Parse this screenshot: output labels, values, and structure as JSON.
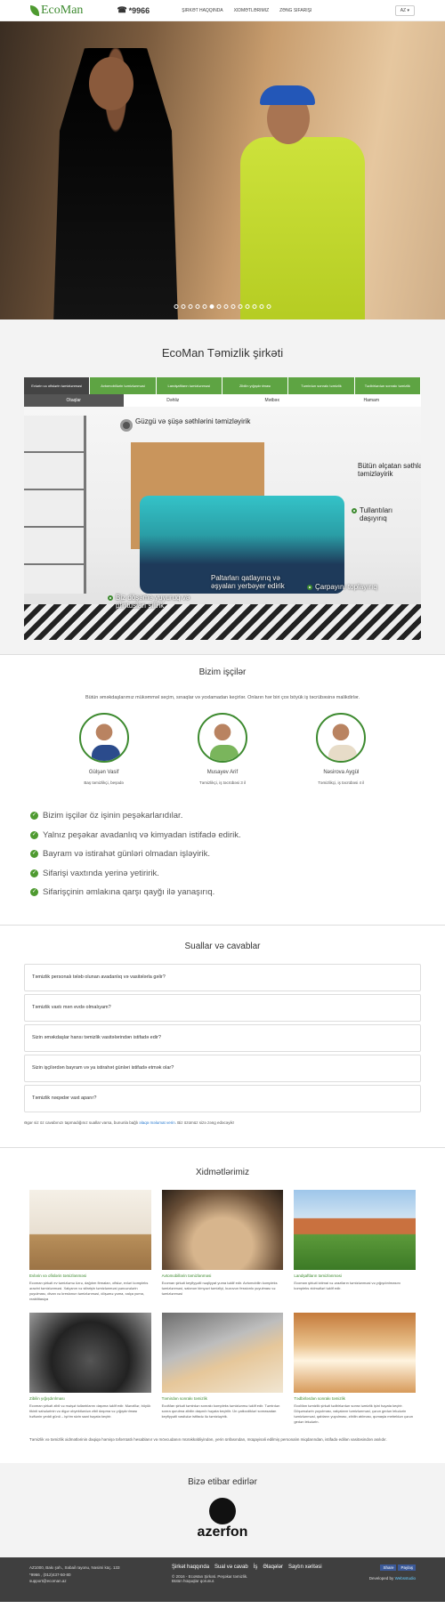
{
  "header": {
    "logo": "EcoMan",
    "phone": "*9966",
    "nav": [
      "Şirkət haqqında",
      "Xidmətlərimiz",
      "Zəng sifarişi"
    ],
    "lang": "AZ ▾"
  },
  "hero": {
    "slide_count": 14,
    "active_slide": 5
  },
  "company": {
    "title": "EcoMan Təmizlik şirkəti",
    "tabs": [
      "Evlərin və ofislərin təmizlənməsi",
      "Avtomobillərin təmizlənməsi",
      "Landşaftların təmizlənməsi",
      "Zibilin yığışdırılması",
      "Təmirdən sonrakı təmizlik",
      "Tədbirlərdən sonrakı təmizlik"
    ],
    "subtabs": [
      "Otaqlar",
      "Dəhliz",
      "Mətbəx",
      "Hamam"
    ],
    "hotspots": {
      "glass": "Güzgü və şüşə səthlərini təmizləyirik",
      "surfaces": "Bütün əlçatan səthləri təmizləyirik",
      "trash": "Tullantıları daşıyırıq",
      "clothes": "Paltarları qatlayırıq və əşyaları yerbəyer edirik",
      "linen": "Çarpayını toplayırıq",
      "floor": "Biz döşəmə yuyuruq və plintusları silirik"
    }
  },
  "workers": {
    "title": "Bizim işçilər",
    "intro": "Bütün əməkdaşlarımız mükəmməl seçim, sınaqlar və yoxlamadan keçirlər. Onların hər biri çox böyük iş təcrübəsinə malikdirlər.",
    "list": [
      {
        "name": "Gülşən Vasif",
        "role": "Baş təmizlikçi, beşədə"
      },
      {
        "name": "Musayev Arif",
        "role": "Təmizlikçi, iş təcrübəsi 3 il"
      },
      {
        "name": "Nəsirova Aygül",
        "role": "Təmizlikçi, iş təcrübəsi 4 il"
      }
    ],
    "checks": [
      "Bizim işçilər öz işinin peşəkarlarıdılar.",
      "Yalnız peşəkar avadanlıq və kimyadan istifadə edirik.",
      "Bayram və istirahət günləri olmadan işləyirik.",
      "Sifarişi vaxtında yerinə yetiririk.",
      "Sifarişçinin əmlakına qarşı qayğı ilə yanaşırıq."
    ]
  },
  "faq": {
    "title": "Suallar və cavablar",
    "items": [
      "Təmizlik personalı tələb olunan avadanlıq və vasitələrla gəlir?",
      "Təmizlik vaxtı mən evdə olmalıyam?",
      "Sizin əməkdaşlar hansı təmizlik vasitələrindən istifadə edir?",
      "Sizin işçilərdən bayram və ya istirahət günləri istifadə etmək olar?",
      "Təmizlik nəqədər vaxt aparır?"
    ],
    "note": "Əgər siz öz cavabınızı tapmadığınız suallar varsa, bununla bağlı",
    "note_link": "əlaqə məlumat verin",
    "note_end": ". Biz özümüz sizə zəng edəcəyik!"
  },
  "services": {
    "title": "Xidmətlərimiz",
    "items": [
      {
        "title": "Evlərin və ofislərin təmizlənməsi",
        "text": "Ecoman şirkəti ev təmizləmə üzrə, dağıtım firmaları, ofislər, evləri kompleks ərazini təmizlənməsi. Xalçanın və sifarişin təmizlənməsi pəncərələrin yuyulması, divan və kreslonun təmizlənməsi, döşəmə yuma, xalça yuma, reabilitasiya"
      },
      {
        "title": "Avtomobillərin təmizlənməsi",
        "text": "Ecoman şirkəti keyfiyyətli nəqliyyat yuma təklif edir. Avtomobilin kompleks təmizlənməsi, salonun kimyəvi təmizliyi, kuzovun fessionlo yuyulması və təmizlənməsi"
      },
      {
        "title": "Landşaftların təmizlənməsi",
        "text": "Ecoman şirkəti ictimai və əraziların təmizlənməsi və yığışdırılmasını kompleks xidmətləri təklif edir."
      },
      {
        "title": "Zibilin yığışdırılması",
        "text": "Ecoman şirkəti zibil və məişət tullantılarını daşıma təklif edir. Mənzillər, böyük tikinti sahələrinin və digər obyektlərdən zibil daşıma və yığışdırılması həftənin yeddi günü – iş/rim sizin saat həyata keçirir."
      },
      {
        "title": "Təmirdən sonrakı təmizlik",
        "text": "EcoMan şirkəti təmirdən sonrakı kompleks təmizlənmə təklif edir. Təmirdən sonra qurulma zibilin daşınıb həyata keçirilir. Ün çatkıcdikləri sonrasadan keyfiyyətli vasitələr istifadə ilə təmizləyirik."
      },
      {
        "title": "Tədbirlərdən sonrakı təmizlik",
        "text": "EcoMan təmizlik şirkəti tədbirlərdən sonra təmizlik işini həyata keçirir. Döşəmələrin yuyulması, xalçaların təmizlənməsi, çərən gedən lekələrin təmizlənməsi, qabların yuyulması, zibilin atılması, qumaşla mebeldən çərən gedən lekələrin."
      }
    ],
    "note": "Təmizlik və təmizlik xidmətlərinin dəqiqə həmişə təfərrüatlı hesablanır və mövcudanın mürəkkəbliyindən, yerin ünfasından, müqayisəli edilmiş personalın miqdarından, istifadə edilən vasitəsindən asılıdır."
  },
  "trust": {
    "title": "Bizə etibar edirlər",
    "brand": "azerfon"
  },
  "footer": {
    "address": "AZ1000, Bakı şəh., Səbail rayonu, Nəsimi küç. 133",
    "phone": "*9966 , (012)437-50-80",
    "email": "support@ecoman.az",
    "links": [
      "Şirkət haqqında",
      "Sual və cavab",
      "İş",
      "Əlaqələr",
      "Saytın xəritəsi"
    ],
    "copyright": "© 2016 - EcoMan Şirkəti. Peşəkar təmizlik.",
    "rights": "Bütün hüquqlar qorunur.",
    "developer": "Developed by",
    "developer_link": "Websstudio",
    "share": [
      "Share",
      "Paylaş"
    ]
  }
}
